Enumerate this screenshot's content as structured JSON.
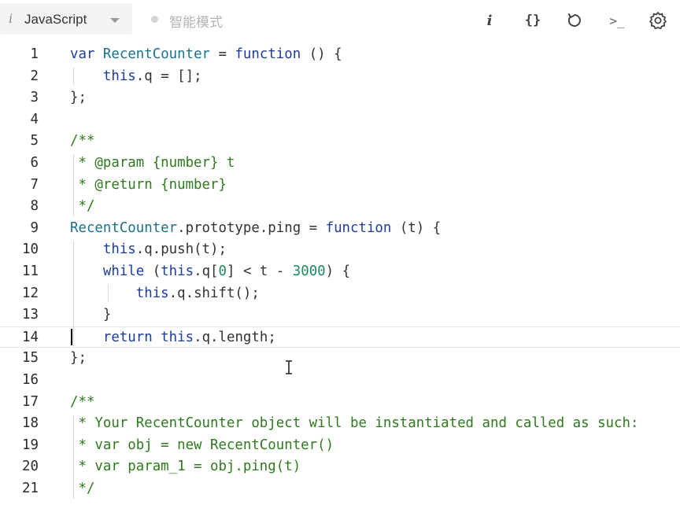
{
  "toolbar": {
    "language_icon": "i",
    "language": "JavaScript",
    "mode_label": "智能模式",
    "info_icon": "i",
    "format_icon": "{}",
    "reset_icon": "reset-icon",
    "console_icon": ">_",
    "settings_icon": "gear-icon"
  },
  "colors": {
    "keyword": "#1f3c99",
    "type": "#1b7189",
    "comment": "#2e7a1d",
    "number": "#1e8a5e",
    "plain": "#333333"
  },
  "editor": {
    "current_line": 14,
    "lines": [
      {
        "n": "1",
        "tokens": [
          [
            "kw",
            "var"
          ],
          [
            "pl",
            " "
          ],
          [
            "ty",
            "RecentCounter"
          ],
          [
            "pl",
            " = "
          ],
          [
            "kw",
            "function"
          ],
          [
            "pl",
            " () {"
          ]
        ]
      },
      {
        "n": "2",
        "tokens": [
          [
            "pl",
            "    "
          ],
          [
            "kw",
            "this"
          ],
          [
            "pl",
            ".q = [];"
          ]
        ]
      },
      {
        "n": "3",
        "tokens": [
          [
            "pl",
            "};"
          ]
        ]
      },
      {
        "n": "4",
        "tokens": []
      },
      {
        "n": "5",
        "tokens": [
          [
            "cm",
            "/**"
          ]
        ]
      },
      {
        "n": "6",
        "tokens": [
          [
            "cm",
            " * @param {number} t"
          ]
        ]
      },
      {
        "n": "7",
        "tokens": [
          [
            "cm",
            " * @return {number}"
          ]
        ]
      },
      {
        "n": "8",
        "tokens": [
          [
            "cm",
            " */"
          ]
        ]
      },
      {
        "n": "9",
        "tokens": [
          [
            "ty",
            "RecentCounter"
          ],
          [
            "pl",
            ".prototype.ping = "
          ],
          [
            "kw",
            "function"
          ],
          [
            "pl",
            " (t) {"
          ]
        ]
      },
      {
        "n": "10",
        "tokens": [
          [
            "pl",
            "    "
          ],
          [
            "kw",
            "this"
          ],
          [
            "pl",
            ".q.push(t);"
          ]
        ]
      },
      {
        "n": "11",
        "tokens": [
          [
            "pl",
            "    "
          ],
          [
            "kw",
            "while"
          ],
          [
            "pl",
            " ("
          ],
          [
            "kw",
            "this"
          ],
          [
            "pl",
            ".q["
          ],
          [
            "nm",
            "0"
          ],
          [
            "pl",
            "] < t - "
          ],
          [
            "nm",
            "3000"
          ],
          [
            "pl",
            ") {"
          ]
        ]
      },
      {
        "n": "12",
        "tokens": [
          [
            "pl",
            "        "
          ],
          [
            "kw",
            "this"
          ],
          [
            "pl",
            ".q.shift();"
          ]
        ]
      },
      {
        "n": "13",
        "tokens": [
          [
            "pl",
            "    }"
          ]
        ]
      },
      {
        "n": "14",
        "tokens": [
          [
            "pl",
            "    "
          ],
          [
            "kw",
            "return"
          ],
          [
            "pl",
            " "
          ],
          [
            "kw",
            "this"
          ],
          [
            "pl",
            ".q.length;"
          ]
        ]
      },
      {
        "n": "15",
        "tokens": [
          [
            "pl",
            "};"
          ]
        ]
      },
      {
        "n": "16",
        "tokens": []
      },
      {
        "n": "17",
        "tokens": [
          [
            "cm",
            "/**"
          ]
        ]
      },
      {
        "n": "18",
        "tokens": [
          [
            "cm",
            " * Your RecentCounter object will be instantiated and called as such:"
          ]
        ]
      },
      {
        "n": "19",
        "tokens": [
          [
            "cm",
            " * var obj = new RecentCounter()"
          ]
        ]
      },
      {
        "n": "20",
        "tokens": [
          [
            "cm",
            " * var param_1 = obj.ping(t)"
          ]
        ]
      },
      {
        "n": "21",
        "tokens": [
          [
            "cm",
            " */"
          ]
        ]
      }
    ]
  }
}
